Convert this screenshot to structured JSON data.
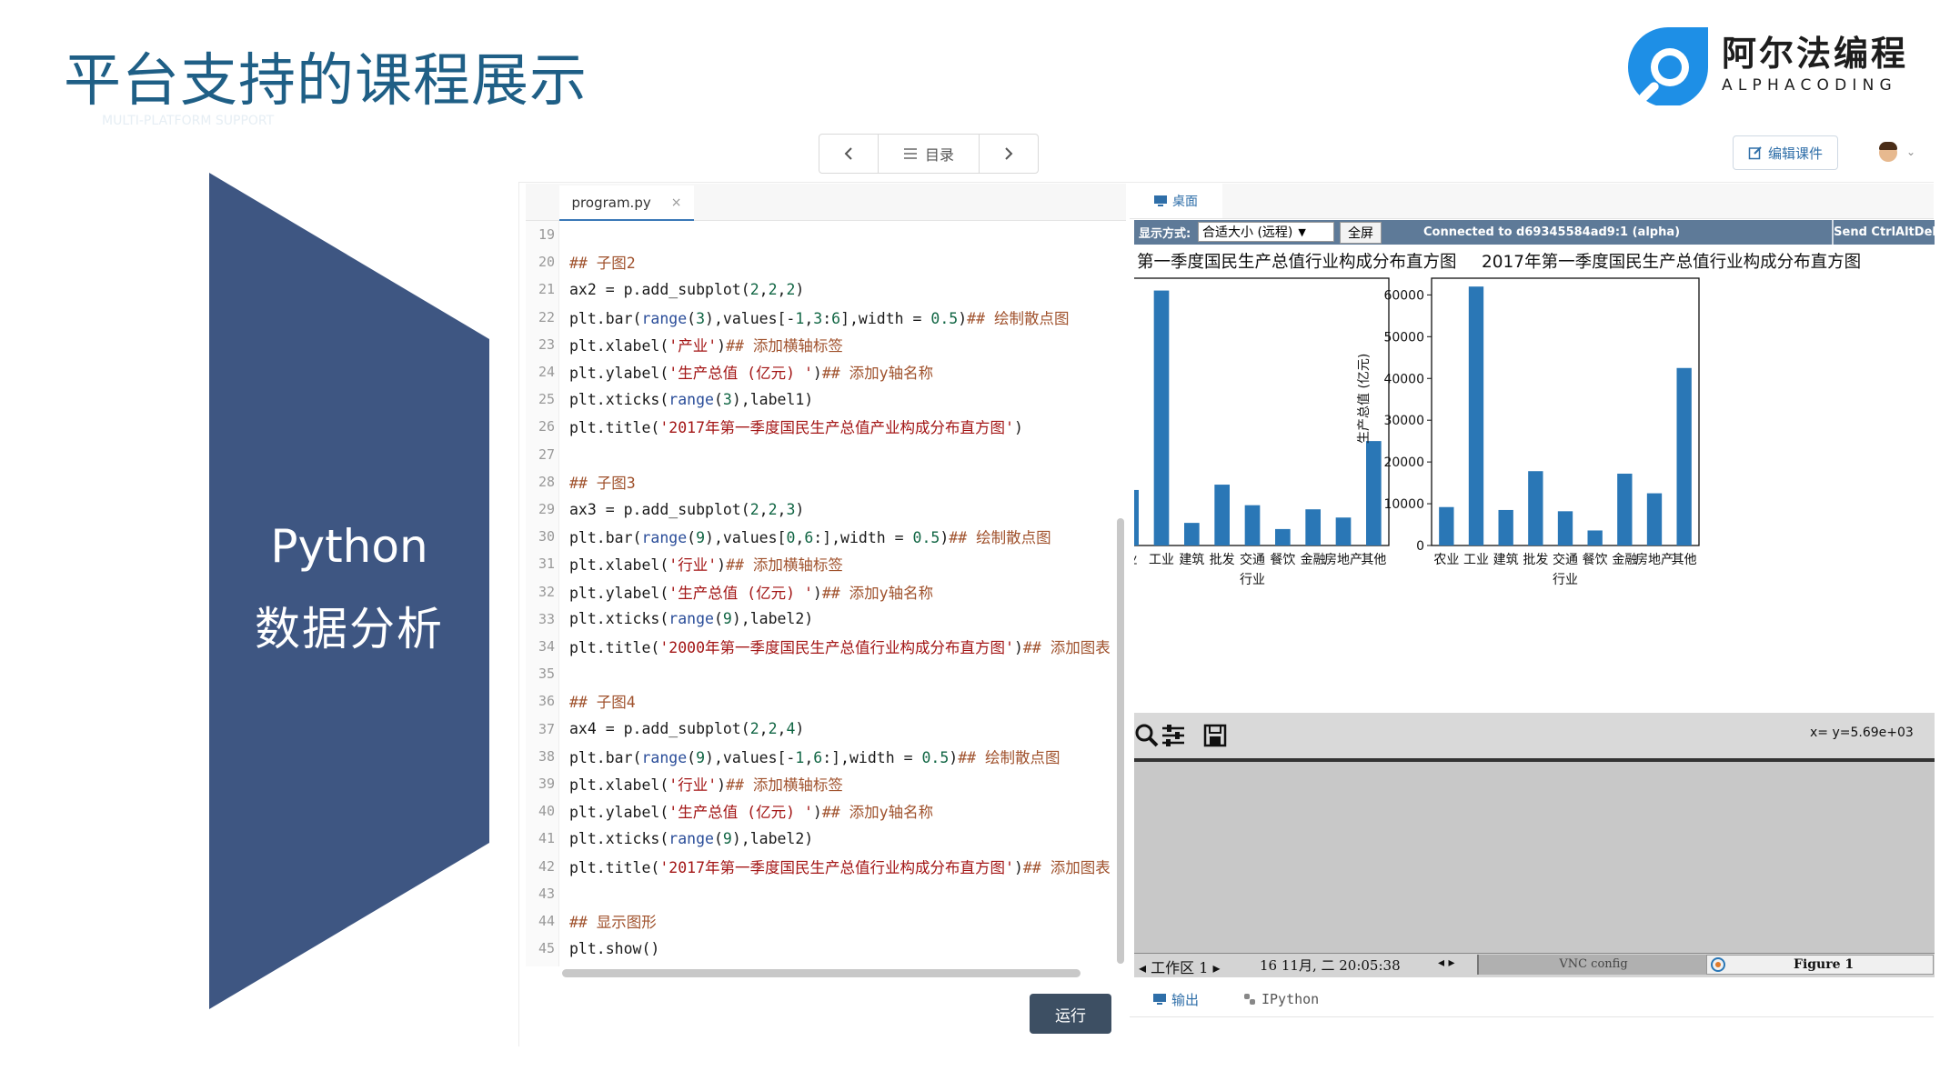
{
  "slide": {
    "title": "平台支持的课程展示",
    "subtitle": "MULTI-PLATFORM SUPPORT",
    "logo_cn": "阿尔法编程",
    "logo_en": "ALPHACODING",
    "panel_line1": "Python",
    "panel_line2": "数据分析",
    "colors": {
      "title": "#1f5f86",
      "panel": "#3e5682",
      "logo_blue": "#1e8fe6"
    }
  },
  "toolbar": {
    "prev_icon": "chevron-left-icon",
    "catalog_label": "目录",
    "next_icon": "chevron-right-icon",
    "edit_label": "编辑课件"
  },
  "editor": {
    "file_tab": "program.py",
    "close_glyph": "×",
    "run_label": "运行",
    "lines": [
      {
        "n": "19",
        "parts": []
      },
      {
        "n": "20",
        "parts": [
          {
            "t": "## 子图2",
            "c": "cm"
          }
        ]
      },
      {
        "n": "21",
        "parts": [
          {
            "t": "ax2 = p.add_subplot(",
            "c": ""
          },
          {
            "t": "2",
            "c": "num"
          },
          {
            "t": ",",
            "c": ""
          },
          {
            "t": "2",
            "c": "num"
          },
          {
            "t": ",",
            "c": ""
          },
          {
            "t": "2",
            "c": "num"
          },
          {
            "t": ")",
            "c": ""
          }
        ]
      },
      {
        "n": "22",
        "parts": [
          {
            "t": "plt.bar(",
            "c": ""
          },
          {
            "t": "range",
            "c": "fn"
          },
          {
            "t": "(",
            "c": ""
          },
          {
            "t": "3",
            "c": "num"
          },
          {
            "t": "),values[-",
            "c": ""
          },
          {
            "t": "1",
            "c": "num"
          },
          {
            "t": ",",
            "c": ""
          },
          {
            "t": "3",
            "c": "num"
          },
          {
            "t": ":",
            "c": ""
          },
          {
            "t": "6",
            "c": "num"
          },
          {
            "t": "],width = ",
            "c": ""
          },
          {
            "t": "0.5",
            "c": "num"
          },
          {
            "t": ")",
            "c": ""
          },
          {
            "t": "## 绘制散点图",
            "c": "cm"
          }
        ]
      },
      {
        "n": "23",
        "parts": [
          {
            "t": "plt.xlabel(",
            "c": ""
          },
          {
            "t": "'产业'",
            "c": "str"
          },
          {
            "t": ")",
            "c": ""
          },
          {
            "t": "## 添加横轴标签",
            "c": "cm"
          }
        ]
      },
      {
        "n": "24",
        "parts": [
          {
            "t": "plt.ylabel(",
            "c": ""
          },
          {
            "t": "'生产总值 (亿元) '",
            "c": "str"
          },
          {
            "t": ")",
            "c": ""
          },
          {
            "t": "## 添加y轴名称",
            "c": "cm"
          }
        ]
      },
      {
        "n": "25",
        "parts": [
          {
            "t": "plt.xticks(",
            "c": ""
          },
          {
            "t": "range",
            "c": "fn"
          },
          {
            "t": "(",
            "c": ""
          },
          {
            "t": "3",
            "c": "num"
          },
          {
            "t": "),label1)",
            "c": ""
          }
        ]
      },
      {
        "n": "26",
        "parts": [
          {
            "t": "plt.title(",
            "c": ""
          },
          {
            "t": "'2017年第一季度国民生产总值产业构成分布直方图'",
            "c": "str"
          },
          {
            "t": ")",
            "c": ""
          }
        ]
      },
      {
        "n": "27",
        "parts": []
      },
      {
        "n": "28",
        "parts": [
          {
            "t": "## 子图3",
            "c": "cm"
          }
        ]
      },
      {
        "n": "29",
        "parts": [
          {
            "t": "ax3 = p.add_subplot(",
            "c": ""
          },
          {
            "t": "2",
            "c": "num"
          },
          {
            "t": ",",
            "c": ""
          },
          {
            "t": "2",
            "c": "num"
          },
          {
            "t": ",",
            "c": ""
          },
          {
            "t": "3",
            "c": "num"
          },
          {
            "t": ")",
            "c": ""
          }
        ]
      },
      {
        "n": "30",
        "parts": [
          {
            "t": "plt.bar(",
            "c": ""
          },
          {
            "t": "range",
            "c": "fn"
          },
          {
            "t": "(",
            "c": ""
          },
          {
            "t": "9",
            "c": "num"
          },
          {
            "t": "),values[",
            "c": ""
          },
          {
            "t": "0",
            "c": "num"
          },
          {
            "t": ",",
            "c": ""
          },
          {
            "t": "6",
            "c": "num"
          },
          {
            "t": ":],width = ",
            "c": ""
          },
          {
            "t": "0.5",
            "c": "num"
          },
          {
            "t": ")",
            "c": ""
          },
          {
            "t": "## 绘制散点图",
            "c": "cm"
          }
        ]
      },
      {
        "n": "31",
        "parts": [
          {
            "t": "plt.xlabel(",
            "c": ""
          },
          {
            "t": "'行业'",
            "c": "str"
          },
          {
            "t": ")",
            "c": ""
          },
          {
            "t": "## 添加横轴标签",
            "c": "cm"
          }
        ]
      },
      {
        "n": "32",
        "parts": [
          {
            "t": "plt.ylabel(",
            "c": ""
          },
          {
            "t": "'生产总值 (亿元) '",
            "c": "str"
          },
          {
            "t": ")",
            "c": ""
          },
          {
            "t": "## 添加y轴名称",
            "c": "cm"
          }
        ]
      },
      {
        "n": "33",
        "parts": [
          {
            "t": "plt.xticks(",
            "c": ""
          },
          {
            "t": "range",
            "c": "fn"
          },
          {
            "t": "(",
            "c": ""
          },
          {
            "t": "9",
            "c": "num"
          },
          {
            "t": "),label2)",
            "c": ""
          }
        ]
      },
      {
        "n": "34",
        "parts": [
          {
            "t": "plt.title(",
            "c": ""
          },
          {
            "t": "'2000年第一季度国民生产总值行业构成分布直方图'",
            "c": "str"
          },
          {
            "t": ")",
            "c": ""
          },
          {
            "t": "## 添加图表",
            "c": "cm"
          }
        ]
      },
      {
        "n": "35",
        "parts": []
      },
      {
        "n": "36",
        "parts": [
          {
            "t": "## 子图4",
            "c": "cm"
          }
        ]
      },
      {
        "n": "37",
        "parts": [
          {
            "t": "ax4 = p.add_subplot(",
            "c": ""
          },
          {
            "t": "2",
            "c": "num"
          },
          {
            "t": ",",
            "c": ""
          },
          {
            "t": "2",
            "c": "num"
          },
          {
            "t": ",",
            "c": ""
          },
          {
            "t": "4",
            "c": "num"
          },
          {
            "t": ")",
            "c": ""
          }
        ]
      },
      {
        "n": "38",
        "parts": [
          {
            "t": "plt.bar(",
            "c": ""
          },
          {
            "t": "range",
            "c": "fn"
          },
          {
            "t": "(",
            "c": ""
          },
          {
            "t": "9",
            "c": "num"
          },
          {
            "t": "),values[-",
            "c": ""
          },
          {
            "t": "1",
            "c": "num"
          },
          {
            "t": ",",
            "c": ""
          },
          {
            "t": "6",
            "c": "num"
          },
          {
            "t": ":],width = ",
            "c": ""
          },
          {
            "t": "0.5",
            "c": "num"
          },
          {
            "t": ")",
            "c": ""
          },
          {
            "t": "## 绘制散点图",
            "c": "cm"
          }
        ]
      },
      {
        "n": "39",
        "parts": [
          {
            "t": "plt.xlabel(",
            "c": ""
          },
          {
            "t": "'行业'",
            "c": "str"
          },
          {
            "t": ")",
            "c": ""
          },
          {
            "t": "## 添加横轴标签",
            "c": "cm"
          }
        ]
      },
      {
        "n": "40",
        "parts": [
          {
            "t": "plt.ylabel(",
            "c": ""
          },
          {
            "t": "'生产总值 (亿元) '",
            "c": "str"
          },
          {
            "t": ")",
            "c": ""
          },
          {
            "t": "## 添加y轴名称",
            "c": "cm"
          }
        ]
      },
      {
        "n": "41",
        "parts": [
          {
            "t": "plt.xticks(",
            "c": ""
          },
          {
            "t": "range",
            "c": "fn"
          },
          {
            "t": "(",
            "c": ""
          },
          {
            "t": "9",
            "c": "num"
          },
          {
            "t": "),label2)",
            "c": ""
          }
        ]
      },
      {
        "n": "42",
        "parts": [
          {
            "t": "plt.title(",
            "c": ""
          },
          {
            "t": "'2017年第一季度国民生产总值行业构成分布直方图'",
            "c": "str"
          },
          {
            "t": ")",
            "c": ""
          },
          {
            "t": "## 添加图表",
            "c": "cm"
          }
        ]
      },
      {
        "n": "43",
        "parts": []
      },
      {
        "n": "44",
        "parts": [
          {
            "t": "## 显示图形",
            "c": "cm"
          }
        ]
      },
      {
        "n": "45",
        "parts": [
          {
            "t": "plt.show()",
            "c": ""
          }
        ]
      }
    ]
  },
  "desktop": {
    "tab_label": "桌面",
    "vnc": {
      "display_label": "显示方式:",
      "display_value": "合适大小 (远程)",
      "fullscreen": "全屏",
      "connected": "Connected to d69345584ad9:1 (alpha)",
      "send": "Send CtrlAltDel"
    },
    "figure": {
      "coords": "x= y=5.69e+03",
      "toolbar_icons": [
        "zoom-icon",
        "configure-icon",
        "save-icon"
      ]
    },
    "taskbar": {
      "workspace": "◂ 工作区  1 ▸",
      "datetime": "16 11月, 二 20:05:38",
      "arrows": "◂ ▸",
      "vnc_config": "VNC config",
      "figure": "Figure 1"
    }
  },
  "output": {
    "tab_output": "输出",
    "tab_ipython": "IPython"
  },
  "chart_data": [
    {
      "type": "bar",
      "title": "第一季度国民生产总值行业构成分布直方图",
      "xlabel": "行业",
      "ylabel": "",
      "categories": [
        "业",
        "工业",
        "建筑",
        "批发",
        "交通",
        "餐饮",
        "金融",
        "房地产",
        "其他"
      ],
      "values": [
        13500,
        62000,
        5500,
        14800,
        9800,
        4000,
        8800,
        6800,
        25400
      ],
      "ylim": [
        0,
        65000
      ],
      "color": "#2a77b6",
      "grid": false
    },
    {
      "type": "bar",
      "title": "2017年第一季度国民生产总值行业构成分布直方图",
      "xlabel": "行业",
      "ylabel": "生产总值 (亿元)",
      "categories": [
        "农业",
        "工业",
        "建筑",
        "批发",
        "交通",
        "餐饮",
        "金融",
        "房地产",
        "其他"
      ],
      "values": [
        9200,
        62000,
        8500,
        17800,
        8200,
        3600,
        17200,
        12500,
        42500
      ],
      "yticks": [
        0,
        10000,
        20000,
        30000,
        40000,
        50000,
        60000
      ],
      "ylim": [
        0,
        64000
      ],
      "color": "#2a77b6",
      "grid": false
    }
  ]
}
